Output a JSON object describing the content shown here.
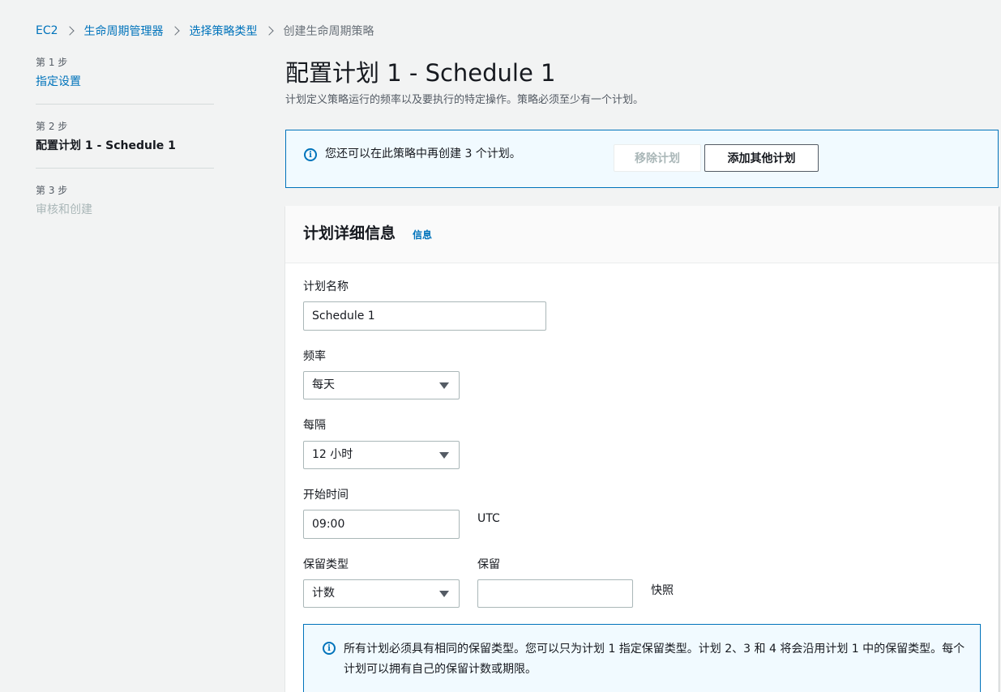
{
  "breadcrumb": {
    "items": [
      "EC2",
      "生命周期管理器",
      "选择策略类型"
    ],
    "current": "创建生命周期策略"
  },
  "steps": [
    {
      "num": "第 1 步",
      "title": "指定设置"
    },
    {
      "num": "第 2 步",
      "title": "配置计划 1 - Schedule 1"
    },
    {
      "num": "第 3 步",
      "title": "审核和创建"
    }
  ],
  "page": {
    "title": "配置计划 1 - Schedule 1",
    "description": "计划定义策略运行的频率以及要执行的特定操作。策略必须至少有一个计划。"
  },
  "alert": {
    "text": "您还可以在此策略中再创建 3 个计划。",
    "remove_label": "移除计划",
    "add_label": "添加其他计划"
  },
  "details": {
    "title": "计划详细信息",
    "info_link": "信息",
    "name_label": "计划名称",
    "name_value": "Schedule 1",
    "frequency_label": "频率",
    "frequency_value": "每天",
    "interval_label": "每隔",
    "interval_value": "12 小时",
    "start_label": "开始时间",
    "start_value": "09:00",
    "start_suffix": "UTC",
    "retention_type_label": "保留类型",
    "retention_type_value": "计数",
    "retain_label": "保留",
    "retain_value": "",
    "retain_suffix": "快照",
    "note": "所有计划必须具有相同的保留类型。您可以只为计划 1 指定保留类型。计划 2、3 和 4 将会沿用计划 1 中的保留类型。每个计划可以拥有自己的保留计数或期限。"
  },
  "colors": {
    "link": "#0073bb",
    "background": "#f2f3f3",
    "info_bg": "#f1faff"
  }
}
